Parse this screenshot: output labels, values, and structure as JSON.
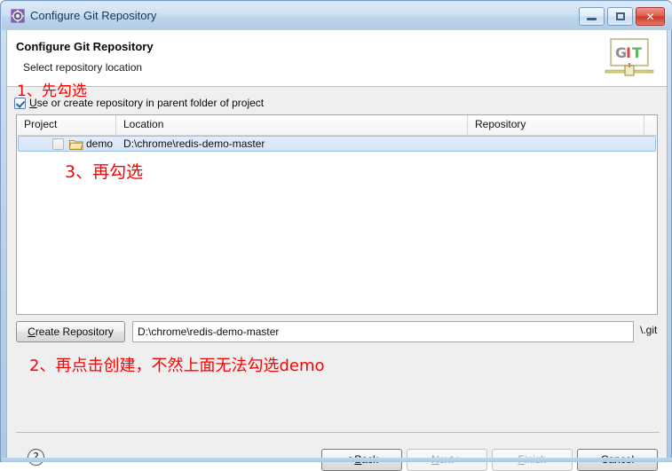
{
  "window": {
    "title": "Configure Git Repository",
    "icon": "eclipse-wizard-icon",
    "controls": {
      "minimize": "minimize-icon",
      "maximize": "maximize-icon",
      "close": "✕"
    }
  },
  "header": {
    "title": "Configure Git Repository",
    "subtitle": "Select repository location",
    "logo_text_g": "G",
    "logo_text_i": "I",
    "logo_text_t": "T",
    "logo_alt": "git-logo"
  },
  "options": {
    "use_parent_folder_label": "Use or create repository in parent folder of project",
    "use_parent_folder_mnemonic": "U",
    "use_parent_folder_rest": "se or create repository in parent folder of project",
    "use_parent_folder_checked": true
  },
  "table": {
    "columns": [
      "Project",
      "Location",
      "Repository"
    ],
    "rows": [
      {
        "checked": false,
        "project": "demo",
        "location": "D:\\chrome\\redis-demo-master",
        "repository": "",
        "selected": true
      }
    ]
  },
  "create_row": {
    "button_mnemonic": "C",
    "button_rest": "reate Repository",
    "button_label": "Create Repository",
    "path_value": "D:\\chrome\\redis-demo-master",
    "path_placeholder": "",
    "suffix": "\\.git"
  },
  "annotations": [
    {
      "id": "anno-1",
      "text": "1、先勾选",
      "color": "#ff0000"
    },
    {
      "id": "anno-3",
      "text": "3、再勾选",
      "color": "#ff0000"
    },
    {
      "id": "anno-2",
      "text": "2、再点击创建，不然上面无法勾选demo",
      "color": "#ff0000"
    }
  ],
  "footer": {
    "help_label": "?",
    "back": {
      "label": "< Back",
      "mnemonic": "B",
      "prefix": "< ",
      "rest": "ack",
      "enabled": true
    },
    "next": {
      "label": "Next >",
      "mnemonic": "N",
      "prefix": "",
      "rest": "ext >",
      "enabled": false
    },
    "finish": {
      "label": "Finish",
      "mnemonic": "F",
      "prefix": "",
      "rest": "inish",
      "enabled": false
    },
    "cancel": {
      "label": "Cancel",
      "enabled": true
    }
  },
  "colors": {
    "accent": "#2a62a8",
    "annotation": "#ff0000",
    "title_bar": "#cde0f2",
    "dialog_bg": "#efeff0",
    "selection": "#d4e4f7"
  }
}
